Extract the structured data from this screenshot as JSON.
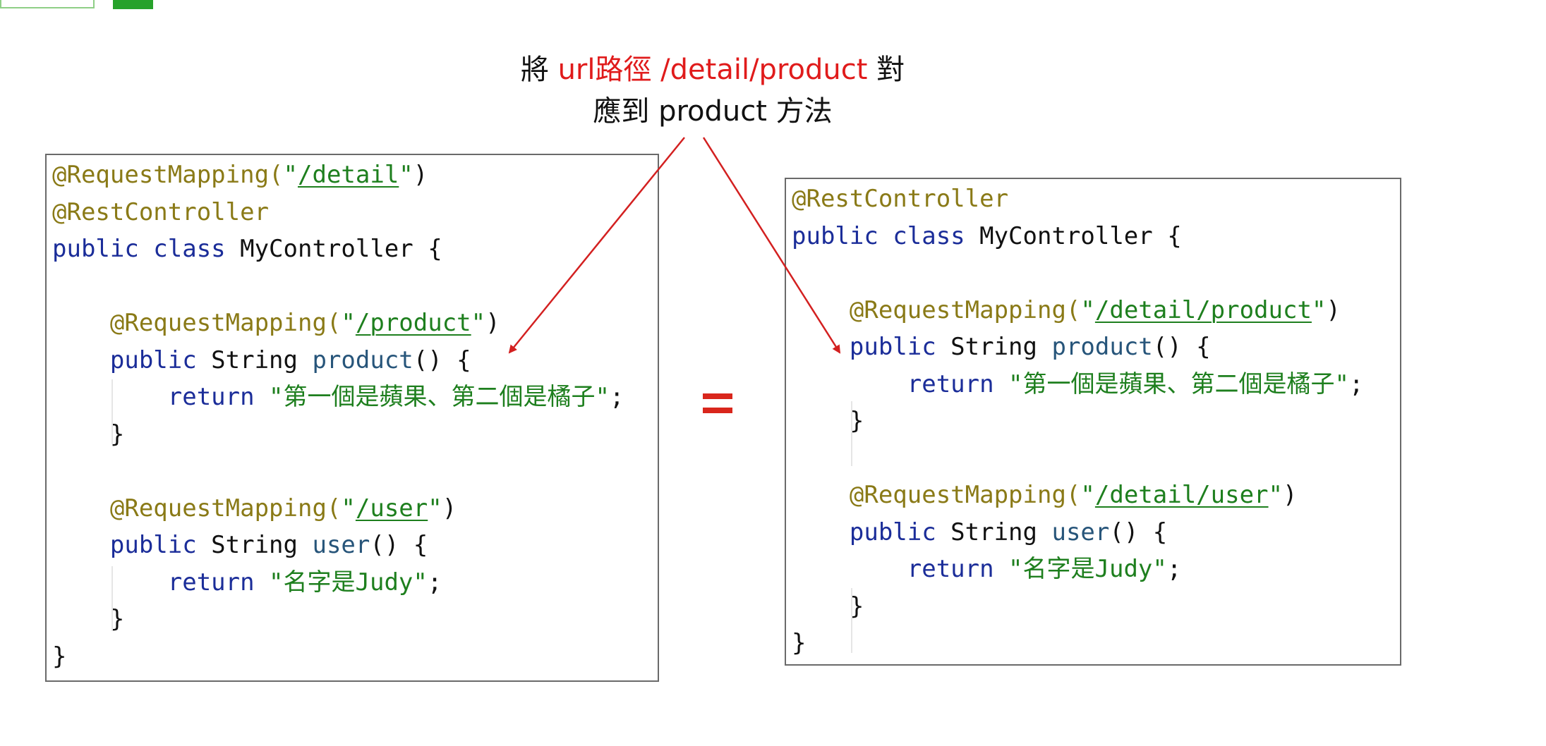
{
  "caption": {
    "line1_before": "將 ",
    "line1_highlight": "url路徑 /detail/product",
    "line1_after": " 對",
    "line2": "應到 product 方法"
  },
  "left_code": {
    "lines": [
      {
        "parts": [
          {
            "t": "@RequestMapping(",
            "c": "ann"
          },
          {
            "t": "\"",
            "c": "str"
          },
          {
            "t": "/detail",
            "c": "str path"
          },
          {
            "t": "\"",
            "c": "str"
          },
          {
            "t": ")",
            "c": ""
          }
        ]
      },
      {
        "parts": [
          {
            "t": "@RestController",
            "c": "ann"
          }
        ]
      },
      {
        "parts": [
          {
            "t": "public class ",
            "c": "kw"
          },
          {
            "t": "MyController {",
            "c": ""
          }
        ]
      },
      {
        "parts": []
      },
      {
        "parts": [
          {
            "t": "    @RequestMapping(",
            "c": "ann"
          },
          {
            "t": "\"",
            "c": "str"
          },
          {
            "t": "/product",
            "c": "str path"
          },
          {
            "t": "\"",
            "c": "str"
          },
          {
            "t": ")",
            "c": ""
          }
        ]
      },
      {
        "parts": [
          {
            "t": "    public ",
            "c": "kw"
          },
          {
            "t": "String ",
            "c": ""
          },
          {
            "t": "product",
            "c": "meth"
          },
          {
            "t": "() {",
            "c": ""
          }
        ]
      },
      {
        "parts": [
          {
            "t": "        return ",
            "c": "kw"
          },
          {
            "t": "\"第一個是蘋果、第二個是橘子\"",
            "c": "str"
          },
          {
            "t": ";",
            "c": ""
          }
        ]
      },
      {
        "parts": [
          {
            "t": "    }",
            "c": ""
          }
        ]
      },
      {
        "parts": []
      },
      {
        "parts": [
          {
            "t": "    @RequestMapping(",
            "c": "ann"
          },
          {
            "t": "\"",
            "c": "str"
          },
          {
            "t": "/user",
            "c": "str path"
          },
          {
            "t": "\"",
            "c": "str"
          },
          {
            "t": ")",
            "c": ""
          }
        ]
      },
      {
        "parts": [
          {
            "t": "    public ",
            "c": "kw"
          },
          {
            "t": "String ",
            "c": ""
          },
          {
            "t": "user",
            "c": "meth"
          },
          {
            "t": "() {",
            "c": ""
          }
        ]
      },
      {
        "parts": [
          {
            "t": "        return ",
            "c": "kw"
          },
          {
            "t": "\"名字是Judy\"",
            "c": "str"
          },
          {
            "t": ";",
            "c": ""
          }
        ]
      },
      {
        "parts": [
          {
            "t": "    }",
            "c": ""
          }
        ]
      },
      {
        "parts": [
          {
            "t": "}",
            "c": ""
          }
        ]
      }
    ]
  },
  "right_code": {
    "lines": [
      {
        "parts": [
          {
            "t": "@RestController",
            "c": "ann"
          }
        ]
      },
      {
        "parts": [
          {
            "t": "public class ",
            "c": "kw"
          },
          {
            "t": "MyController {",
            "c": ""
          }
        ]
      },
      {
        "parts": []
      },
      {
        "parts": [
          {
            "t": "    @RequestMapping(",
            "c": "ann"
          },
          {
            "t": "\"",
            "c": "str"
          },
          {
            "t": "/detail/product",
            "c": "str path"
          },
          {
            "t": "\"",
            "c": "str"
          },
          {
            "t": ")",
            "c": ""
          }
        ]
      },
      {
        "parts": [
          {
            "t": "    public ",
            "c": "kw"
          },
          {
            "t": "String ",
            "c": ""
          },
          {
            "t": "product",
            "c": "meth"
          },
          {
            "t": "() {",
            "c": ""
          }
        ]
      },
      {
        "parts": [
          {
            "t": "        return ",
            "c": "kw"
          },
          {
            "t": "\"第一個是蘋果、第二個是橘子\"",
            "c": "str"
          },
          {
            "t": ";",
            "c": ""
          }
        ]
      },
      {
        "parts": [
          {
            "t": "    }",
            "c": ""
          }
        ]
      },
      {
        "parts": []
      },
      {
        "parts": [
          {
            "t": "    @RequestMapping(",
            "c": "ann"
          },
          {
            "t": "\"",
            "c": "str"
          },
          {
            "t": "/detail/user",
            "c": "str path"
          },
          {
            "t": "\"",
            "c": "str"
          },
          {
            "t": ")",
            "c": ""
          }
        ]
      },
      {
        "parts": [
          {
            "t": "    public ",
            "c": "kw"
          },
          {
            "t": "String ",
            "c": ""
          },
          {
            "t": "user",
            "c": "meth"
          },
          {
            "t": "() {",
            "c": ""
          }
        ]
      },
      {
        "parts": [
          {
            "t": "        return ",
            "c": "kw"
          },
          {
            "t": "\"名字是Judy\"",
            "c": "str"
          },
          {
            "t": ";",
            "c": ""
          }
        ]
      },
      {
        "parts": [
          {
            "t": "    }",
            "c": ""
          }
        ]
      },
      {
        "parts": [
          {
            "t": "}",
            "c": ""
          }
        ]
      }
    ]
  },
  "colors": {
    "arrow": "#d32020",
    "equals": "#d9261c",
    "highlight": "#e01b1b"
  }
}
